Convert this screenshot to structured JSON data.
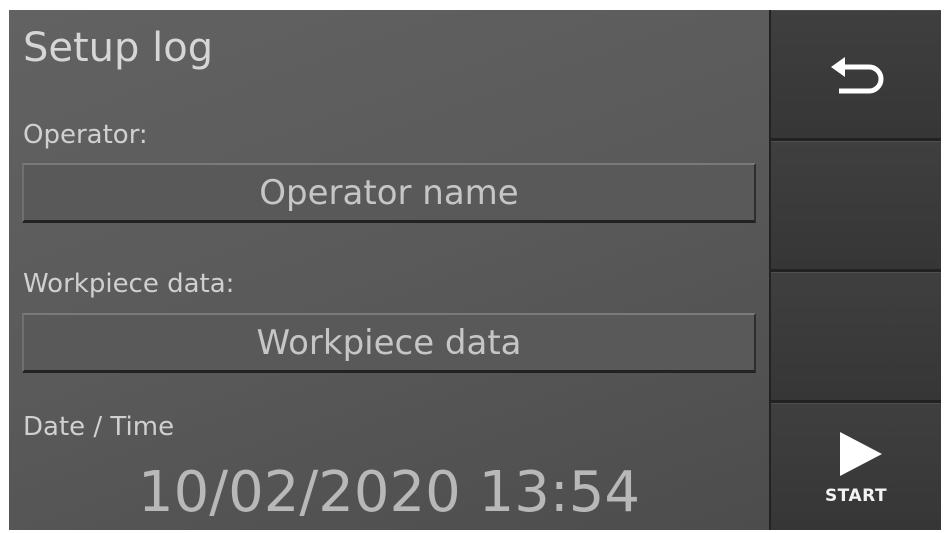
{
  "screen": {
    "title": "Setup log"
  },
  "form": {
    "operator_label": "Operator:",
    "operator_value": "Operator name",
    "workpiece_label": "Workpiece data:",
    "workpiece_value": "Workpiece data",
    "datetime_label": "Date / Time",
    "datetime_value": "10/02/2020 13:54"
  },
  "sidebar": {
    "buttons": [
      {
        "icon": "back-arrow-icon",
        "label": ""
      },
      {
        "icon": "",
        "label": ""
      },
      {
        "icon": "",
        "label": ""
      },
      {
        "icon": "play-icon",
        "label": "START"
      }
    ]
  },
  "colors": {
    "panel_bg": "#5a5a5a",
    "sidebar_bg": "#363636",
    "text": "#d0d0d0",
    "icon": "#ffffff"
  }
}
